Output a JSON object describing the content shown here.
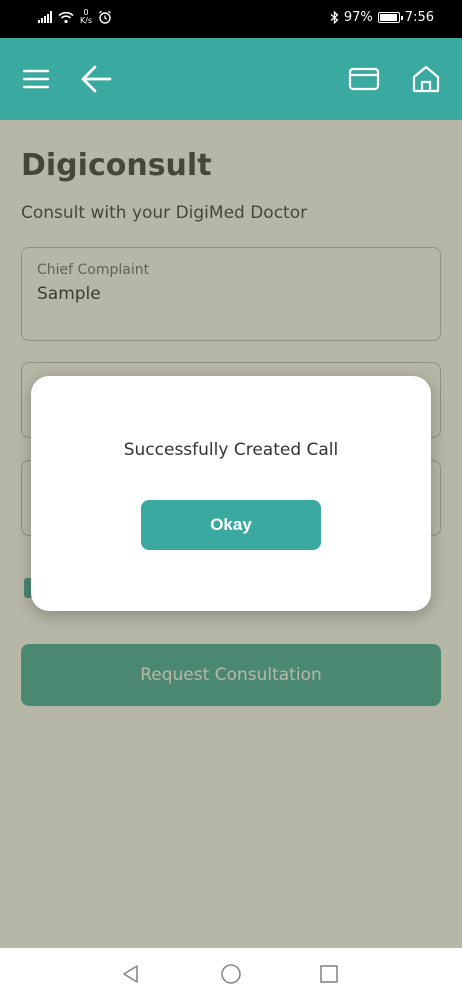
{
  "status_bar": {
    "net_speed_value": "0",
    "net_speed_unit": "K/s",
    "battery": "97%",
    "time": "7:56",
    "icons": [
      "signal-icon",
      "wifi-icon",
      "alarm-icon",
      "bluetooth-icon",
      "battery-icon"
    ]
  },
  "header": {
    "icons": [
      "menu-icon",
      "back-arrow-icon",
      "card-icon",
      "home-icon"
    ]
  },
  "page": {
    "title": "Digiconsult",
    "subtitle": "Consult with your DigiMed Doctor"
  },
  "form": {
    "chief_complaint_label": "Chief Complaint",
    "chief_complaint_value": "Sample",
    "request_button": "Request Consultation"
  },
  "dialog": {
    "message": "Successfully Created Call",
    "okay_button": "Okay"
  },
  "nav_bar": {
    "icons": [
      "back-triangle-icon",
      "home-circle-icon",
      "recents-square-icon"
    ]
  },
  "colors": {
    "accent": "#3aa99f",
    "status_bar": "#000000",
    "overlay": "rgba(95,95,60,0.45)"
  }
}
